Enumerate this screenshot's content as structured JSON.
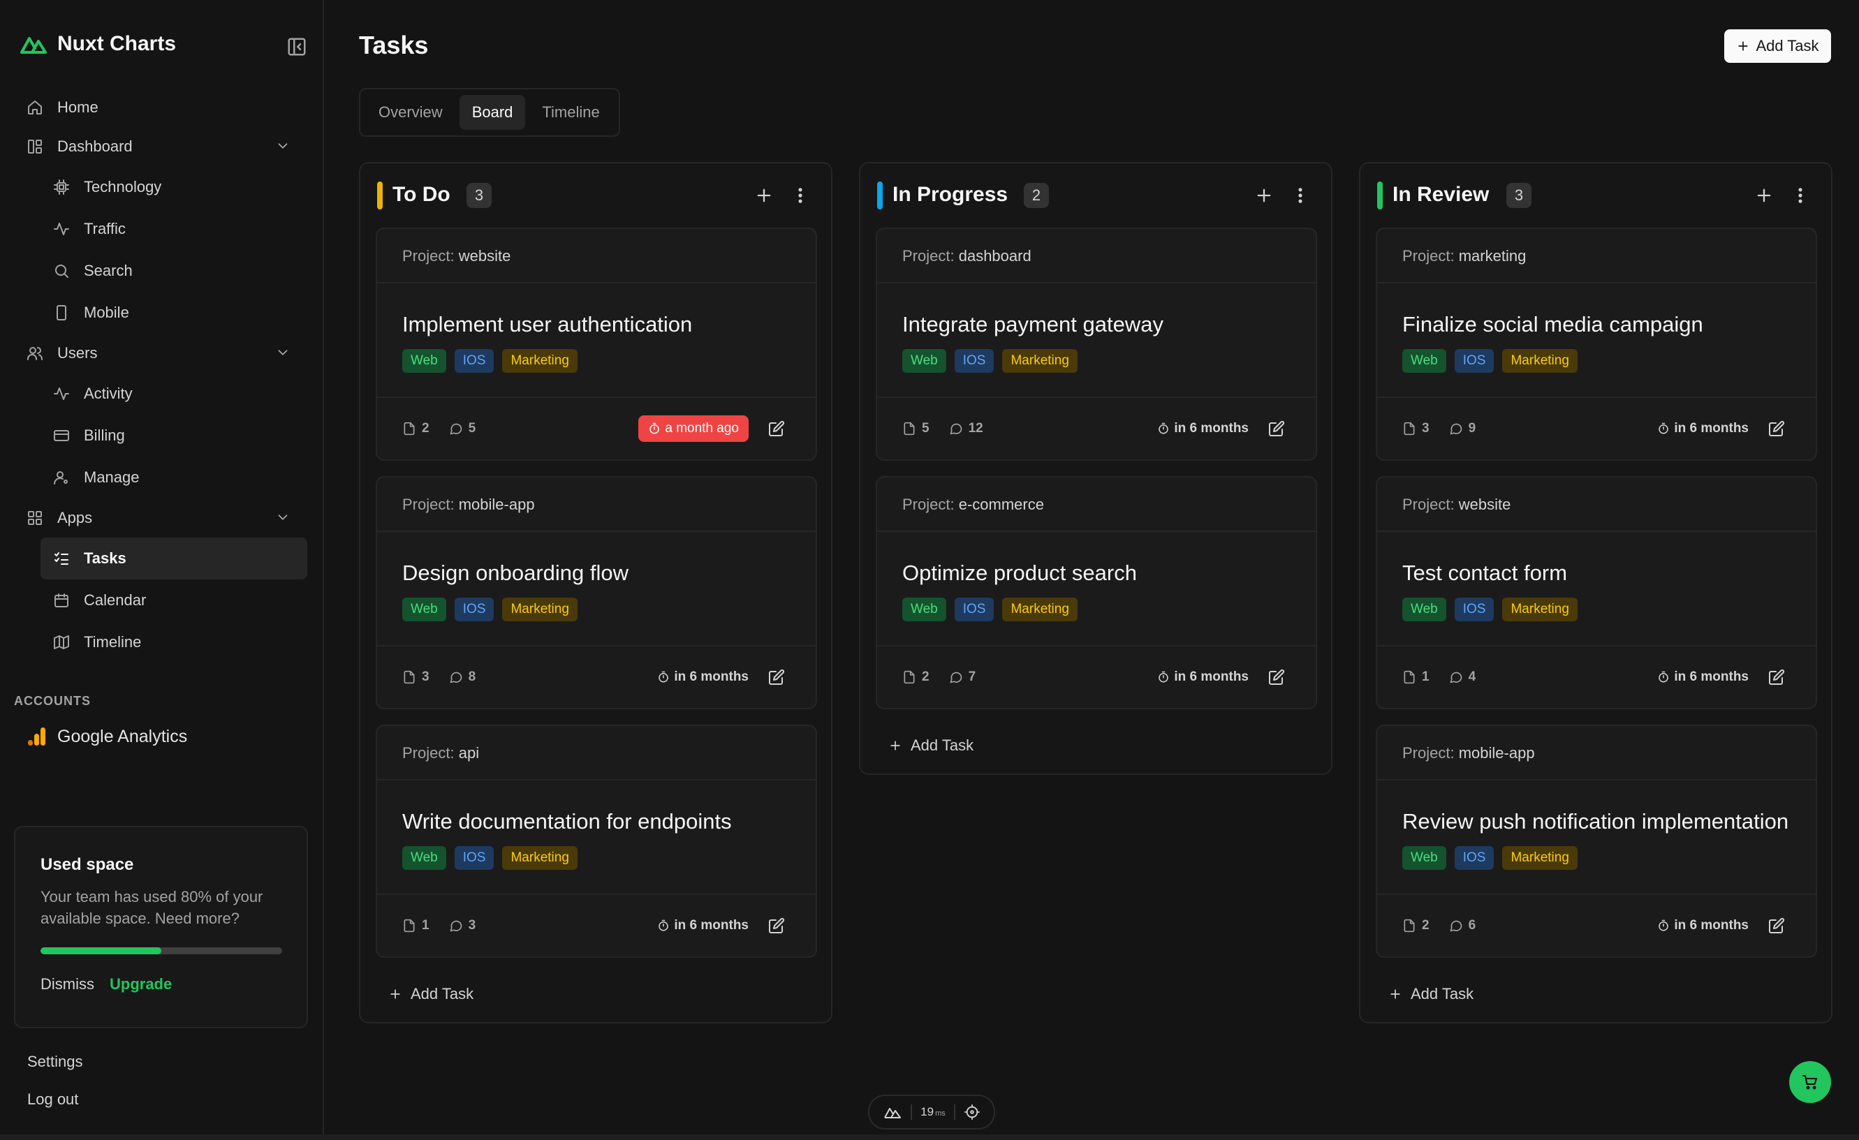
{
  "brand": {
    "name": "Nuxt Charts"
  },
  "sidebar": {
    "items": [
      {
        "label": "Home",
        "icon": "home-icon"
      },
      {
        "label": "Dashboard",
        "icon": "dashboard-icon",
        "expandable": true
      },
      {
        "label": "Technology",
        "icon": "cpu-icon",
        "sub": true
      },
      {
        "label": "Traffic",
        "icon": "activity-icon",
        "sub": true
      },
      {
        "label": "Search",
        "icon": "search-icon",
        "sub": true
      },
      {
        "label": "Mobile",
        "icon": "smartphone-icon",
        "sub": true
      },
      {
        "label": "Users",
        "icon": "users-icon",
        "expandable": true
      },
      {
        "label": "Activity",
        "icon": "activity-icon",
        "sub": true
      },
      {
        "label": "Billing",
        "icon": "credit-card-icon",
        "sub": true
      },
      {
        "label": "Manage",
        "icon": "user-cog-icon",
        "sub": true
      },
      {
        "label": "Apps",
        "icon": "grid-icon",
        "expandable": true
      },
      {
        "label": "Tasks",
        "icon": "list-checks-icon",
        "sub": true,
        "active": true
      },
      {
        "label": "Calendar",
        "icon": "calendar-icon",
        "sub": true
      },
      {
        "label": "Timeline",
        "icon": "map-icon",
        "sub": true
      }
    ],
    "accounts_label": "ACCOUNTS",
    "account": "Google Analytics",
    "space": {
      "title": "Used space",
      "desc": "Your team has used 80% of your available space. Need more?",
      "progress": 0.5,
      "dismiss": "Dismiss",
      "upgrade": "Upgrade"
    },
    "settings": "Settings",
    "logout": "Log out"
  },
  "header": {
    "title": "Tasks",
    "add_task": "Add Task"
  },
  "tabs": [
    {
      "label": "Overview",
      "active": false
    },
    {
      "label": "Board",
      "active": true
    },
    {
      "label": "Timeline",
      "active": false
    }
  ],
  "project_prefix": "Project",
  "column_add_label": "Add Task",
  "badges": [
    {
      "label": "Web",
      "bg": "#14532d",
      "fg": "#4ade80"
    },
    {
      "label": "IOS",
      "bg": "#1e3a5f",
      "fg": "#60a5fa"
    },
    {
      "label": "Marketing",
      "bg": "#4a3a0a",
      "fg": "#facc15"
    }
  ],
  "columns": [
    {
      "title": "To Do",
      "count": "3",
      "color": "#eab308",
      "cards": [
        {
          "project": "website",
          "title": "Implement user authentication",
          "files": "2",
          "comments": "5",
          "due": "a month ago",
          "overdue": true
        },
        {
          "project": "mobile-app",
          "title": "Design onboarding flow",
          "files": "3",
          "comments": "8",
          "due": "in 6 months",
          "overdue": false
        },
        {
          "project": "api",
          "title": "Write documentation for endpoints",
          "files": "1",
          "comments": "3",
          "due": "in 6 months",
          "overdue": false
        }
      ]
    },
    {
      "title": "In Progress",
      "count": "2",
      "color": "#0ea5e9",
      "cards": [
        {
          "project": "dashboard",
          "title": "Integrate payment gateway",
          "files": "5",
          "comments": "12",
          "due": "in 6 months",
          "overdue": false
        },
        {
          "project": "e-commerce",
          "title": "Optimize product search",
          "files": "2",
          "comments": "7",
          "due": "in 6 months",
          "overdue": false
        }
      ]
    },
    {
      "title": "In Review",
      "count": "3",
      "color": "#22c55e",
      "cards": [
        {
          "project": "marketing",
          "title": "Finalize social media campaign",
          "files": "3",
          "comments": "9",
          "due": "in 6 months",
          "overdue": false
        },
        {
          "project": "website",
          "title": "Test contact form",
          "files": "1",
          "comments": "4",
          "due": "in 6 months",
          "overdue": false
        },
        {
          "project": "mobile-app",
          "title": "Review push notification implementation",
          "files": "2",
          "comments": "6",
          "due": "in 6 months",
          "overdue": false
        }
      ]
    }
  ],
  "devbar": {
    "time": "19",
    "unit": "ms"
  }
}
